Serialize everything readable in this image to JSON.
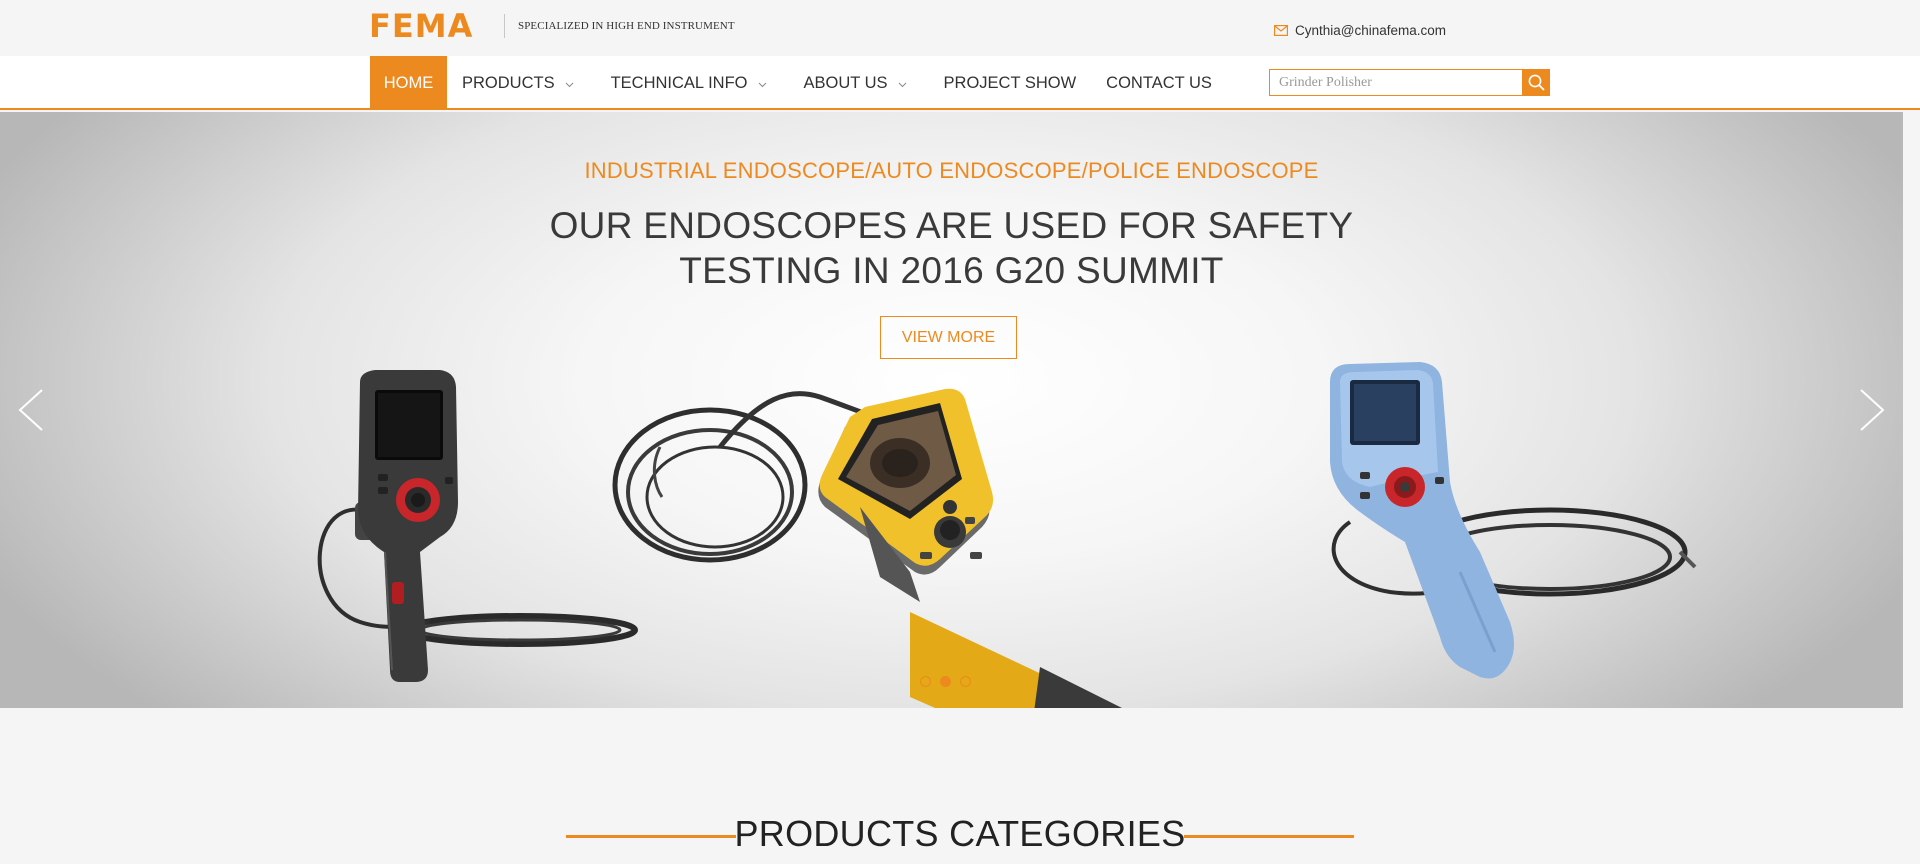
{
  "brand": {
    "logo": "FEMA",
    "tagline": "SPECIALIZED IN HIGH END INSTRUMENT",
    "color": "#ed8a1f"
  },
  "contact": {
    "email": "Cynthia@chinafema.com"
  },
  "nav": {
    "items": [
      {
        "label": "HOME",
        "active": true,
        "dropdown": false
      },
      {
        "label": "PRODUCTS",
        "dropdown": true
      },
      {
        "label": "TECHNICAL INFO",
        "dropdown": true
      },
      {
        "label": "ABOUT US",
        "dropdown": true
      },
      {
        "label": "PROJECT SHOW",
        "dropdown": false
      },
      {
        "label": "CONTACT US",
        "dropdown": false
      }
    ]
  },
  "search": {
    "placeholder": "Grinder Polisher",
    "icon": "search-icon"
  },
  "hero": {
    "subtitle": "INDUSTRIAL ENDOSCOPE/AUTO ENDOSCOPE/POLICE ENDOSCOPE",
    "title_line1": "OUR ENDOSCOPES ARE USED FOR SAFETY",
    "title_line2": "TESTING IN 2016 G20 SUMMIT",
    "cta": "VIEW MORE",
    "slides": 3,
    "active_slide": 2
  },
  "section": {
    "title": "PRODUCTS CATEGORIES"
  }
}
